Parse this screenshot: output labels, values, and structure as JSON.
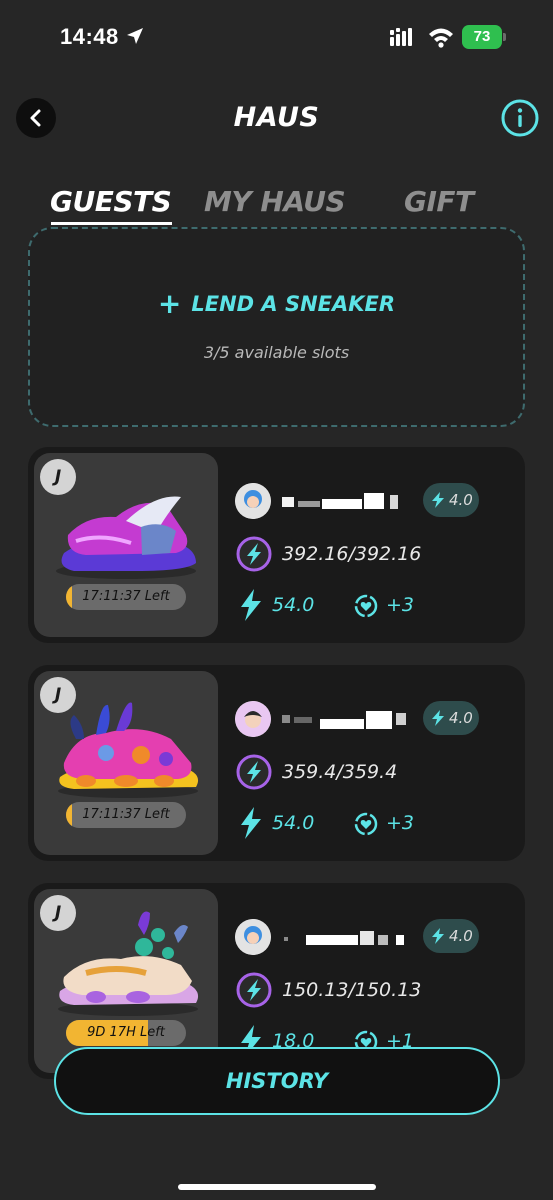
{
  "status_bar": {
    "time": "14:48",
    "battery": "73",
    "icons": [
      "location-arrow-icon",
      "signal-icon",
      "wifi-icon",
      "battery-icon"
    ]
  },
  "header": {
    "title": "HAUS",
    "back_icon": "chevron-left-icon",
    "info_icon": "info-icon"
  },
  "tabs": [
    {
      "label": "GUESTS",
      "active": true
    },
    {
      "label": "MY HAUS",
      "active": false
    },
    {
      "label": "GIFT",
      "active": false
    }
  ],
  "lend": {
    "button_label": "LEND A SNEAKER",
    "slots_text": "3/5 available slots"
  },
  "guests": [
    {
      "badge": "J",
      "timer": "17:11:37 Left",
      "timer_fraction": 0.05,
      "level": "4.0",
      "energy": "392.16/392.16",
      "bolt": "54.0",
      "heart": "+3"
    },
    {
      "badge": "J",
      "timer": "17:11:37 Left",
      "timer_fraction": 0.05,
      "level": "4.0",
      "energy": "359.4/359.4",
      "bolt": "54.0",
      "heart": "+3"
    },
    {
      "badge": "J",
      "timer": "9D 17H Left",
      "timer_fraction": 0.68,
      "level": "4.0",
      "energy": "150.13/150.13",
      "bolt": "18.0",
      "heart": "+1"
    }
  ],
  "history": {
    "label": "HISTORY"
  },
  "colors": {
    "accent": "#5ce3e6",
    "background": "#262626",
    "card": "#1a1a1a",
    "timer_fill": "#f2b532"
  }
}
